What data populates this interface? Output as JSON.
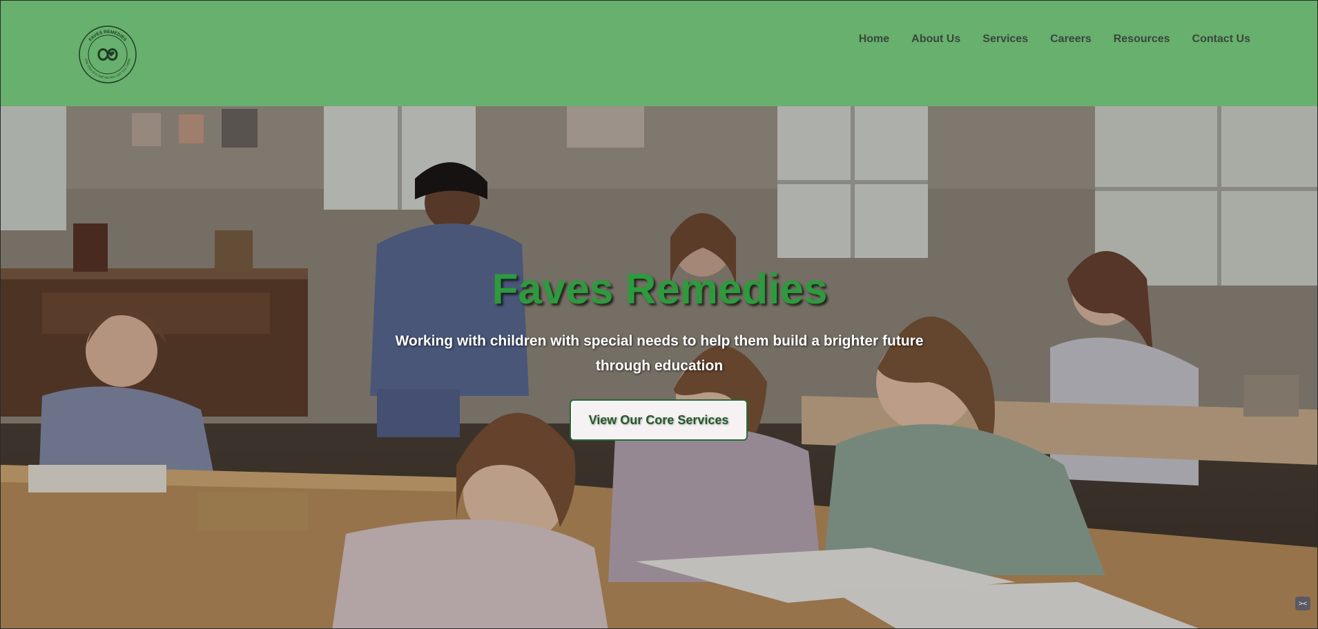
{
  "header": {
    "logo": {
      "icon": "infinity-heart-logo",
      "ring_text_top": "FAVES REMEDIES",
      "ring_text_bottom": "ONE STEP AT A TIME WE WILL GET YOU THERE"
    },
    "nav": [
      {
        "label": "Home",
        "icon": null
      },
      {
        "label": "About Us",
        "icon": null
      },
      {
        "label": "Services",
        "icon": null
      },
      {
        "label": "Careers",
        "icon": null
      },
      {
        "label": "Resources",
        "icon": null
      },
      {
        "label": "Contact Us",
        "icon": null
      }
    ]
  },
  "hero": {
    "title": "Faves Remedies",
    "subtitle": "Working with children with special needs to help them build a brighter future through education",
    "cta_label": "View Our Core Services",
    "background": "classroom-photo"
  },
  "colors": {
    "header_bg": "#67b06d",
    "nav_text": "#39473b",
    "title_green": "#2d9a3e",
    "cta_border": "#256b33",
    "cta_bg": "#f6f1f2"
  },
  "corner_badge": {
    "icon": "code-icon",
    "text": "><"
  }
}
